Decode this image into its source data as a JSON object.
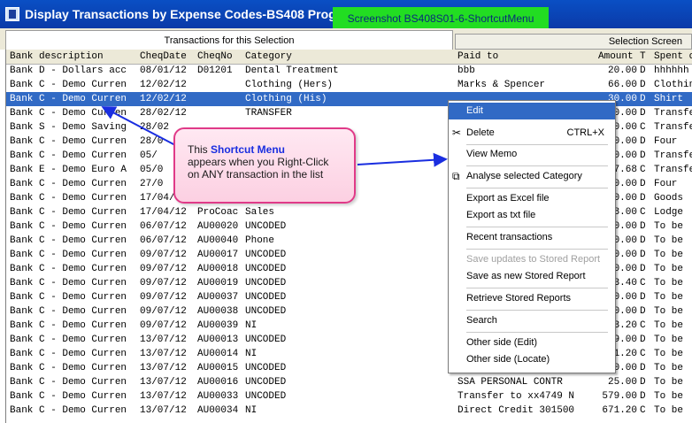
{
  "window": {
    "title": "Display Transactions by Expense Codes-BS408  Prog.Ver",
    "screenshot_label": "Screenshot BS408S01-6-ShortcutMenu"
  },
  "tabs": [
    {
      "label": "Transactions for this Selection"
    },
    {
      "label": "Selection Screen"
    }
  ],
  "columns": [
    "Bank description",
    "CheqDate",
    "CheqNo",
    "Category",
    "Paid to",
    "Amount",
    "T",
    "Spent on"
  ],
  "rows": [
    [
      "Bank D - Dollars acc",
      "08/01/12",
      "D01201",
      "Dental Treatment",
      "bbb",
      "20.00",
      "D",
      "hhhhhh"
    ],
    [
      "Bank C - Demo Curren",
      "12/02/12",
      "",
      "Clothing (Hers)",
      "Marks & Spencer",
      "66.00",
      "D",
      "Clothing"
    ],
    [
      "Bank C - Demo Curren",
      "12/02/12",
      "",
      "Clothing (His)",
      "",
      "30.00",
      "D",
      "Shirt"
    ],
    [
      "Bank C - Demo Curren",
      "28/02/12",
      "",
      "TRANSFER",
      "",
      "00.00",
      "D",
      "Transfer"
    ],
    [
      "Bank S - Demo Saving",
      "28/02",
      "",
      "",
      "",
      "00.00",
      "C",
      "Transfer"
    ],
    [
      "Bank C - Demo Curren",
      "28/0",
      "",
      "",
      "",
      "00.00",
      "D",
      "Four"
    ],
    [
      "Bank C - Demo Curren",
      "05/",
      "",
      "",
      "",
      "00.00",
      "D",
      "Transfer"
    ],
    [
      "Bank E - Demo Euro A",
      "05/0",
      "",
      "",
      "",
      "27.68",
      "C",
      "Transfer"
    ],
    [
      "Bank C - Demo Curren",
      "27/0",
      "",
      "",
      "",
      "20.00",
      "D",
      "Four"
    ],
    [
      "Bank C - Demo Curren",
      "17/04/",
      "",
      "",
      "",
      "00.00",
      "D",
      "Goods"
    ],
    [
      "Bank C - Demo Curren",
      "17/04/12",
      "ProCoac",
      "Sales",
      "",
      "38.00",
      "C",
      "Lodge"
    ],
    [
      "Bank C - Demo Curren",
      "06/07/12",
      "AU00020",
      "UNCODED",
      "",
      "00.00",
      "D",
      "To be"
    ],
    [
      "Bank C - Demo Curren",
      "06/07/12",
      "AU00040",
      "Phone",
      "",
      "00.00",
      "D",
      "To be"
    ],
    [
      "Bank C - Demo Curren",
      "09/07/12",
      "AU00017",
      "UNCODED",
      "",
      "40.00",
      "D",
      "To be"
    ],
    [
      "Bank C - Demo Curren",
      "09/07/12",
      "AU00018",
      "UNCODED",
      "",
      "00.00",
      "D",
      "To be"
    ],
    [
      "Bank C - Demo Curren",
      "09/07/12",
      "AU00019",
      "UNCODED",
      "",
      "53.40",
      "C",
      "To be"
    ],
    [
      "Bank C - Demo Curren",
      "09/07/12",
      "AU00037",
      "UNCODED",
      "",
      "40.00",
      "D",
      "To be"
    ],
    [
      "Bank C - Demo Curren",
      "09/07/12",
      "AU00038",
      "UNCODED",
      "",
      "00.00",
      "D",
      "To be"
    ],
    [
      "Bank C - Demo Curren",
      "09/07/12",
      "AU00039",
      "NI",
      "",
      "53.20",
      "C",
      "To be"
    ],
    [
      "Bank C - Demo Curren",
      "13/07/12",
      "AU00013",
      "UNCODED",
      "",
      "79.00",
      "D",
      "To be"
    ],
    [
      "Bank C - Demo Curren",
      "13/07/12",
      "AU00014",
      "NI",
      "",
      "71.20",
      "C",
      "To be"
    ],
    [
      "Bank C - Demo Curren",
      "13/07/12",
      "AU00015",
      "UNCODED",
      "",
      "00.00",
      "D",
      "To be"
    ],
    [
      "Bank C - Demo Curren",
      "13/07/12",
      "AU00016",
      "UNCODED",
      "SSA PERSONAL CONTR",
      "25.00",
      "D",
      "To be"
    ],
    [
      "Bank C - Demo Curren",
      "13/07/12",
      "AU00033",
      "UNCODED",
      "Transfer to xx4749 N",
      "579.00",
      "D",
      "To be"
    ],
    [
      "Bank C - Demo Curren",
      "13/07/12",
      "AU00034",
      "NI",
      "Direct Credit 301500",
      "671.20",
      "C",
      "To be"
    ]
  ],
  "callout": {
    "prefix": "This ",
    "highlight": "Shortcut Menu",
    "line2": "appears when you Right-Click",
    "line3": "on ANY transaction in the list"
  },
  "menu": {
    "items": [
      {
        "label": "Edit",
        "shortcut": ""
      },
      {
        "label": "Delete",
        "shortcut": "CTRL+X"
      },
      {
        "label": "View Memo",
        "shortcut": ""
      },
      {
        "label": "Analyse selected Category",
        "shortcut": ""
      },
      {
        "label": "Export as Excel file",
        "shortcut": ""
      },
      {
        "label": "Export as txt file",
        "shortcut": ""
      },
      {
        "label": "Recent transactions",
        "shortcut": ""
      },
      {
        "label": "Save updates to Stored Report",
        "shortcut": ""
      },
      {
        "label": "Save as new Stored Report",
        "shortcut": ""
      },
      {
        "label": "Retrieve Stored Reports",
        "shortcut": ""
      },
      {
        "label": "Search",
        "shortcut": ""
      },
      {
        "label": "Other side (Edit)",
        "shortcut": ""
      },
      {
        "label": "Other side (Locate)",
        "shortcut": ""
      }
    ]
  },
  "colors": {
    "titlebar": "#0b3aa8",
    "selection": "#316ac5",
    "screenshot_label_bg": "#22dd22",
    "callout_border": "#e03a88",
    "callout_highlight": "#1a2ee0"
  }
}
